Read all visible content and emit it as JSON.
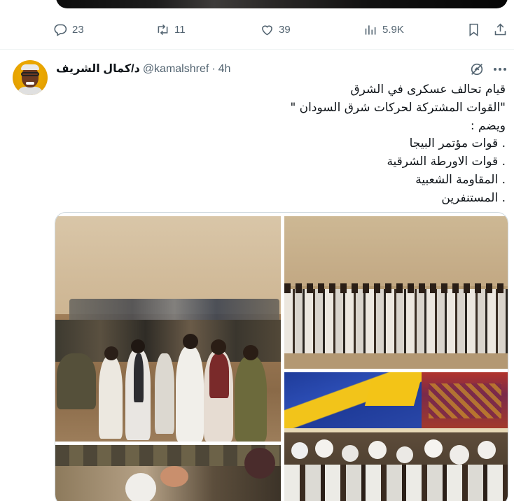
{
  "actions": {
    "reply_count": "23",
    "retweet_count": "11",
    "like_count": "39",
    "views_count": "5.9K"
  },
  "tweet": {
    "display_name": "د/كمال الشريف",
    "handle": "@kamalshref",
    "separator": "·",
    "time": "4h",
    "lines": [
      "قيام تحالف عسكرى في الشرق",
      "\"القوات المشتركة لحركات شرق السودان \"",
      "ويضم :",
      ". قوات مؤتمر البيجا",
      ". قوات الاورطة الشرقية",
      ". المقاومة الشعبية",
      ". المستنفرين"
    ]
  },
  "icons": {
    "reply": "reply-icon",
    "retweet": "retweet-icon",
    "like": "heart-icon",
    "views": "views-icon",
    "bookmark": "bookmark-icon",
    "share": "share-icon",
    "grok": "grok-icon",
    "more": "more-icon"
  },
  "colors": {
    "secondary_text": "#536471",
    "border": "#cfd9de",
    "divider": "#eff3f4"
  }
}
